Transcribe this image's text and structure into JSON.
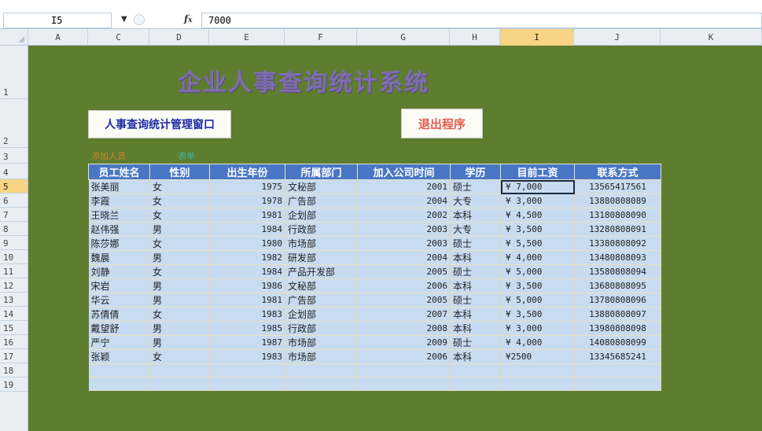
{
  "formula_bar": {
    "name_box": "I5",
    "fx_label": "f",
    "formula": "7000"
  },
  "columns": [
    "A",
    "C",
    "D",
    "E",
    "F",
    "G",
    "H",
    "I",
    "J",
    "K"
  ],
  "selected_column": "I",
  "rows": [
    "1",
    "2",
    "3",
    "4",
    "5",
    "6",
    "7",
    "8",
    "9",
    "10",
    "11",
    "12",
    "13",
    "14",
    "15",
    "16",
    "17",
    "18",
    "19"
  ],
  "selected_row": "5",
  "sheet": {
    "title": "企业人事查询统计系统",
    "mgmt_button": "人事查询统计管理窗口",
    "exit_button": "退出程序",
    "row3_left": "添加人员",
    "row3_right": "表单",
    "colors": {
      "background": "#5e7d2e",
      "header": "#4a76c6",
      "cell": "#c9dbf0",
      "title": "#7e6dae"
    }
  },
  "table": {
    "headers": [
      "员工姓名",
      "性别",
      "出生年份",
      "所属部门",
      "加入公司时间",
      "学历",
      "目前工资",
      "联系方式"
    ],
    "rows": [
      [
        "张美丽",
        "女",
        "1975",
        "文秘部",
        "2001",
        "硕士",
        "¥   7,000",
        "13565417561"
      ],
      [
        "李霞",
        "女",
        "1978",
        "广告部",
        "2004",
        "大专",
        "¥   3,000",
        "13880808089"
      ],
      [
        "王晓兰",
        "女",
        "1981",
        "企划部",
        "2002",
        "本科",
        "¥   4,500",
        "13180808090"
      ],
      [
        "赵伟强",
        "男",
        "1984",
        "行政部",
        "2003",
        "大专",
        "¥   3,500",
        "13280808091"
      ],
      [
        "陈莎娜",
        "女",
        "1980",
        "市场部",
        "2003",
        "硕士",
        "¥   5,500",
        "13380808092"
      ],
      [
        "魏晨",
        "男",
        "1982",
        "研发部",
        "2004",
        "本科",
        "¥   4,000",
        "13480808093"
      ],
      [
        "刘静",
        "女",
        "1984",
        "产品开发部",
        "2005",
        "硕士",
        "¥   5,000",
        "13580808094"
      ],
      [
        "宋岩",
        "男",
        "1986",
        "文秘部",
        "2006",
        "本科",
        "¥   3,500",
        "13680808095"
      ],
      [
        "华云",
        "男",
        "1981",
        "广告部",
        "2005",
        "硕士",
        "¥   5,000",
        "13780808096"
      ],
      [
        "苏倩倩",
        "女",
        "1983",
        "企划部",
        "2007",
        "本科",
        "¥   3,500",
        "13880808097"
      ],
      [
        "戴望舒",
        "男",
        "1985",
        "行政部",
        "2008",
        "本科",
        "¥   3,000",
        "13980808098"
      ],
      [
        "严宁",
        "男",
        "1987",
        "市场部",
        "2009",
        "硕士",
        "¥   4,000",
        "14080808099"
      ],
      [
        "张颖",
        "女",
        "1983",
        "市场部",
        "2006",
        "本科",
        "¥2500",
        "13345685241"
      ]
    ]
  }
}
